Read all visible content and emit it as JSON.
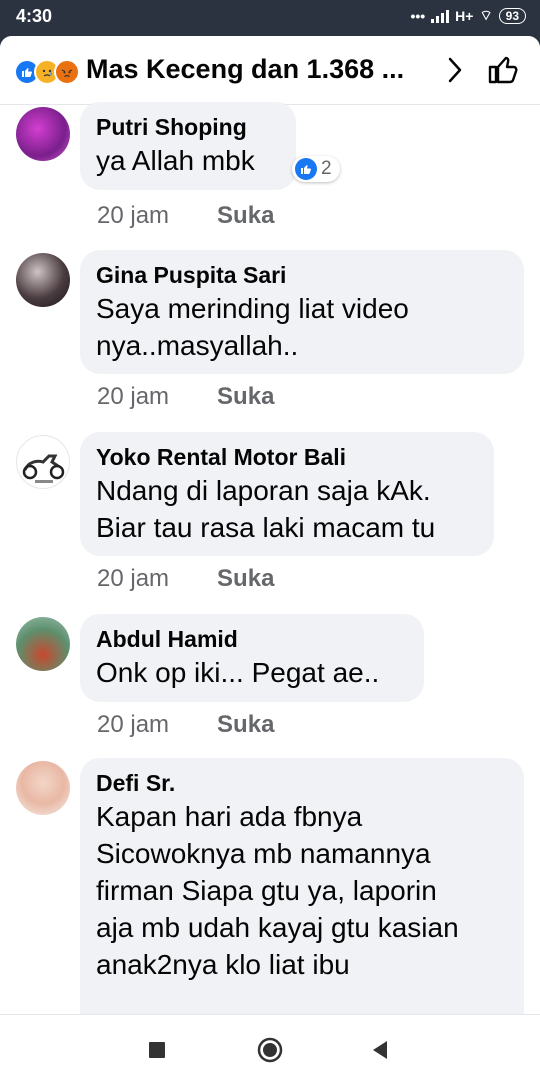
{
  "status": {
    "time": "4:30",
    "network": "H+",
    "battery": "93"
  },
  "header": {
    "title": "Mas Keceng dan 1.368 ...",
    "reactions": [
      "like-icon",
      "sad-icon",
      "angry-icon"
    ]
  },
  "comments": [
    {
      "name": "Putri Shoping",
      "lines": [
        "ya Allah mbk"
      ],
      "time": "20 jam",
      "like_label": "Suka",
      "reaction_count": "2"
    },
    {
      "name": "Gina Puspita Sari",
      "lines": [
        "Saya merinding liat video",
        "nya..masyallah.."
      ],
      "time": "20 jam",
      "like_label": "Suka"
    },
    {
      "name": "Yoko Rental Motor Bali",
      "lines": [
        "Ndang di laporan saja kAk.",
        "Biar tau rasa laki macam tu"
      ],
      "time": "20 jam",
      "like_label": "Suka"
    },
    {
      "name": "Abdul Hamid",
      "lines": [
        "Onk op iki... Pegat ae.."
      ],
      "time": "20 jam",
      "like_label": "Suka"
    },
    {
      "name": "Defi Sr.",
      "lines": [
        "Kapan hari ada fbnya",
        "Sicowoknya mb namannya",
        "firman Siapa gtu ya, laporin",
        "aja mb udah kayaj gtu kasian",
        "anak2nya klo liat ibu"
      ]
    }
  ],
  "colors": {
    "accent": "#1877f2",
    "bubble": "#f0f2f5",
    "meta": "#65676b"
  }
}
